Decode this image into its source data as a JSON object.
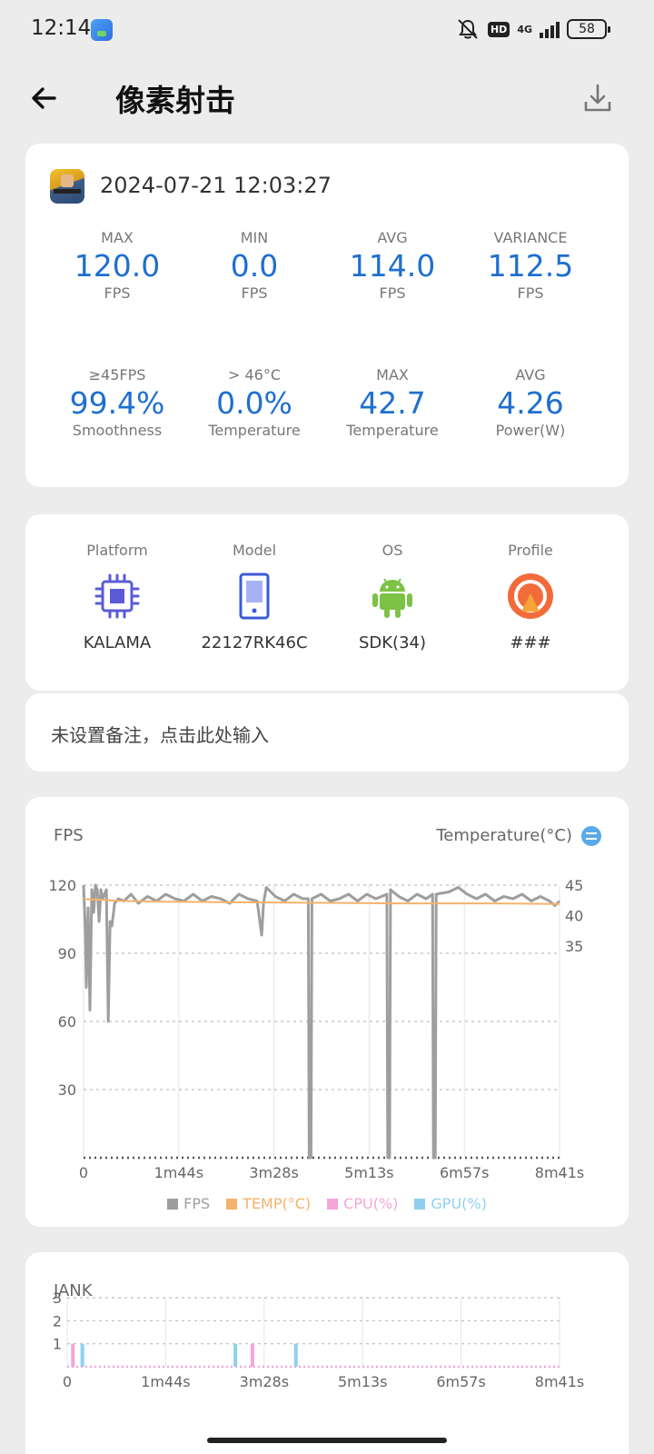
{
  "status_bar": {
    "time": "12:14",
    "hd": "HD",
    "network": "4G",
    "battery": "58",
    "icons": [
      "gallery-app-icon",
      "mute-icon",
      "hd-icon",
      "signal-icon",
      "battery-icon"
    ]
  },
  "app_bar": {
    "title": "像素射击",
    "back_icon": "arrow-left-icon",
    "download_icon": "download-icon"
  },
  "summary": {
    "game_icon": "game-icon",
    "datetime": "2024-07-21 12:03:27",
    "stats": [
      {
        "top": "MAX",
        "value": "120.0",
        "bottom": "FPS"
      },
      {
        "top": "MIN",
        "value": "0.0",
        "bottom": "FPS"
      },
      {
        "top": "AVG",
        "value": "114.0",
        "bottom": "FPS"
      },
      {
        "top": "VARIANCE",
        "value": "112.5",
        "bottom": "FPS"
      },
      {
        "top": "≥45FPS",
        "value": "99.4%",
        "bottom": "Smoothness"
      },
      {
        "top": "> 46°C",
        "value": "0.0%",
        "bottom": "Temperature"
      },
      {
        "top": "MAX",
        "value": "42.7",
        "bottom": "Temperature"
      },
      {
        "top": "AVG",
        "value": "4.26",
        "bottom": "Power(W)"
      }
    ],
    "value_color": "#1e6fd0"
  },
  "device": [
    {
      "label": "Platform",
      "value": "KALAMA",
      "icon": "chip-icon"
    },
    {
      "label": "Model",
      "value": "22127RK46C",
      "icon": "phone-icon"
    },
    {
      "label": "OS",
      "value": "SDK(34)",
      "icon": "android-icon"
    },
    {
      "label": "Profile",
      "value": "###",
      "icon": "profile-icon"
    }
  ],
  "note": {
    "text": "未设置备注，点击此处输入"
  },
  "fps_chart": {
    "title_left": "FPS",
    "title_right": "Temperature(°C)",
    "swap_icon": "swap-axis-icon",
    "legend": [
      {
        "label": "FPS",
        "color": "#9e9e9e"
      },
      {
        "label": "TEMP(°C)",
        "color": "#f5b26b"
      },
      {
        "label": "CPU(%)",
        "color": "#f4a6d7"
      },
      {
        "label": "GPU(%)",
        "color": "#8fd0f0"
      }
    ]
  },
  "jank_chart": {
    "title": "JANK"
  },
  "chart_data": [
    {
      "type": "line",
      "title": "FPS",
      "x_ticks": [
        "0",
        "1m44s",
        "3m28s",
        "5m13s",
        "6m57s",
        "8m41s"
      ],
      "x_range_s": [
        0,
        521
      ],
      "y_left_ticks": [
        120,
        90,
        60,
        30
      ],
      "y_left_range": [
        0,
        120
      ],
      "y_right_label": "Temperature(°C)",
      "y_right_ticks": [
        45,
        40,
        35
      ],
      "grid": true,
      "legend_position": "bottom",
      "series": [
        {
          "name": "FPS",
          "color": "#9e9e9e",
          "points": [
            [
              0,
              120
            ],
            [
              2,
              100
            ],
            [
              3,
              75
            ],
            [
              5,
              110
            ],
            [
              6,
              90
            ],
            [
              7,
              65
            ],
            [
              9,
              118
            ],
            [
              11,
              108
            ],
            [
              13,
              120
            ],
            [
              15,
              118
            ],
            [
              17,
              104
            ],
            [
              19,
              118
            ],
            [
              21,
              114
            ],
            [
              23,
              116
            ],
            [
              25,
              118
            ],
            [
              27,
              60
            ],
            [
              29,
              104
            ],
            [
              31,
              102
            ],
            [
              34,
              112
            ],
            [
              38,
              114
            ],
            [
              44,
              113
            ],
            [
              52,
              116
            ],
            [
              60,
              112
            ],
            [
              70,
              115
            ],
            [
              80,
              113
            ],
            [
              90,
              116
            ],
            [
              100,
              114
            ],
            [
              110,
              113
            ],
            [
              120,
              116
            ],
            [
              130,
              113
            ],
            [
              140,
              115
            ],
            [
              150,
              114
            ],
            [
              160,
              112
            ],
            [
              170,
              116
            ],
            [
              180,
              114
            ],
            [
              190,
              113
            ],
            [
              195,
              98
            ],
            [
              197,
              112
            ],
            [
              200,
              119
            ],
            [
              210,
              115
            ],
            [
              220,
              113
            ],
            [
              230,
              116
            ],
            [
              240,
              114
            ],
            [
              246,
              114
            ],
            [
              247,
              0
            ],
            [
              249,
              0
            ],
            [
              250,
              114
            ],
            [
              260,
              116
            ],
            [
              270,
              113
            ],
            [
              280,
              114
            ],
            [
              290,
              116
            ],
            [
              300,
              113
            ],
            [
              310,
              116
            ],
            [
              320,
              114
            ],
            [
              332,
              116
            ],
            [
              333,
              0
            ],
            [
              335,
              0
            ],
            [
              336,
              118
            ],
            [
              345,
              115
            ],
            [
              355,
              113
            ],
            [
              365,
              116
            ],
            [
              375,
              114
            ],
            [
              382,
              116
            ],
            [
              383,
              0
            ],
            [
              385,
              0
            ],
            [
              386,
              116
            ],
            [
              400,
              117
            ],
            [
              410,
              119
            ],
            [
              420,
              116
            ],
            [
              430,
              114
            ],
            [
              440,
              116
            ],
            [
              450,
              113
            ],
            [
              460,
              115
            ],
            [
              470,
              114
            ],
            [
              480,
              116
            ],
            [
              490,
              113
            ],
            [
              500,
              115
            ],
            [
              510,
              113
            ],
            [
              516,
              111
            ],
            [
              521,
              113
            ]
          ]
        },
        {
          "name": "TEMP(°C)",
          "color": "#f5b26b",
          "points": [
            [
              0,
              42.7
            ],
            [
              20,
              42.6
            ],
            [
              40,
              42.4
            ],
            [
              80,
              42.3
            ],
            [
              150,
              42.2
            ],
            [
              250,
              42.1
            ],
            [
              350,
              42.0
            ],
            [
              450,
              42.0
            ],
            [
              521,
              41.9
            ]
          ]
        },
        {
          "name": "CPU(%)",
          "color": "#f4a6d7",
          "points": []
        },
        {
          "name": "GPU(%)",
          "color": "#8fd0f0",
          "points": []
        }
      ]
    },
    {
      "type": "bar",
      "title": "JANK",
      "x_ticks": [
        "0",
        "1m44s",
        "3m28s",
        "5m13s",
        "6m57s",
        "8m41s"
      ],
      "x_range_s": [
        0,
        521
      ],
      "y_ticks": [
        3,
        2,
        1,
        0
      ],
      "y_range": [
        0,
        3
      ],
      "grid": true,
      "series": [
        {
          "name": "CPU(%)",
          "color": "#f4a6d7",
          "x": [
            6,
            196
          ],
          "values": [
            1,
            1
          ]
        },
        {
          "name": "GPU(%)",
          "color": "#8fd0f0",
          "x": [
            16,
            178,
            242
          ],
          "values": [
            1,
            1,
            1
          ]
        }
      ]
    }
  ]
}
